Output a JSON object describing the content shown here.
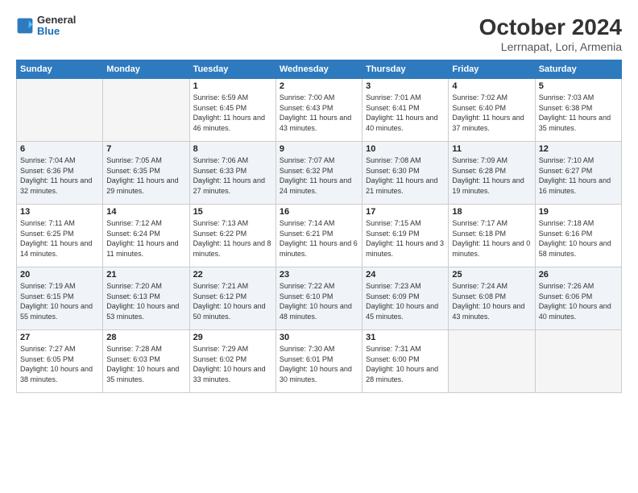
{
  "header": {
    "logo_line1": "General",
    "logo_line2": "Blue",
    "title": "October 2024",
    "subtitle": "Lerrnapat, Lori, Armenia"
  },
  "days_of_week": [
    "Sunday",
    "Monday",
    "Tuesday",
    "Wednesday",
    "Thursday",
    "Friday",
    "Saturday"
  ],
  "weeks": [
    [
      {
        "num": "",
        "info": ""
      },
      {
        "num": "",
        "info": ""
      },
      {
        "num": "1",
        "info": "Sunrise: 6:59 AM\nSunset: 6:45 PM\nDaylight: 11 hours and 46 minutes."
      },
      {
        "num": "2",
        "info": "Sunrise: 7:00 AM\nSunset: 6:43 PM\nDaylight: 11 hours and 43 minutes."
      },
      {
        "num": "3",
        "info": "Sunrise: 7:01 AM\nSunset: 6:41 PM\nDaylight: 11 hours and 40 minutes."
      },
      {
        "num": "4",
        "info": "Sunrise: 7:02 AM\nSunset: 6:40 PM\nDaylight: 11 hours and 37 minutes."
      },
      {
        "num": "5",
        "info": "Sunrise: 7:03 AM\nSunset: 6:38 PM\nDaylight: 11 hours and 35 minutes."
      }
    ],
    [
      {
        "num": "6",
        "info": "Sunrise: 7:04 AM\nSunset: 6:36 PM\nDaylight: 11 hours and 32 minutes."
      },
      {
        "num": "7",
        "info": "Sunrise: 7:05 AM\nSunset: 6:35 PM\nDaylight: 11 hours and 29 minutes."
      },
      {
        "num": "8",
        "info": "Sunrise: 7:06 AM\nSunset: 6:33 PM\nDaylight: 11 hours and 27 minutes."
      },
      {
        "num": "9",
        "info": "Sunrise: 7:07 AM\nSunset: 6:32 PM\nDaylight: 11 hours and 24 minutes."
      },
      {
        "num": "10",
        "info": "Sunrise: 7:08 AM\nSunset: 6:30 PM\nDaylight: 11 hours and 21 minutes."
      },
      {
        "num": "11",
        "info": "Sunrise: 7:09 AM\nSunset: 6:28 PM\nDaylight: 11 hours and 19 minutes."
      },
      {
        "num": "12",
        "info": "Sunrise: 7:10 AM\nSunset: 6:27 PM\nDaylight: 11 hours and 16 minutes."
      }
    ],
    [
      {
        "num": "13",
        "info": "Sunrise: 7:11 AM\nSunset: 6:25 PM\nDaylight: 11 hours and 14 minutes."
      },
      {
        "num": "14",
        "info": "Sunrise: 7:12 AM\nSunset: 6:24 PM\nDaylight: 11 hours and 11 minutes."
      },
      {
        "num": "15",
        "info": "Sunrise: 7:13 AM\nSunset: 6:22 PM\nDaylight: 11 hours and 8 minutes."
      },
      {
        "num": "16",
        "info": "Sunrise: 7:14 AM\nSunset: 6:21 PM\nDaylight: 11 hours and 6 minutes."
      },
      {
        "num": "17",
        "info": "Sunrise: 7:15 AM\nSunset: 6:19 PM\nDaylight: 11 hours and 3 minutes."
      },
      {
        "num": "18",
        "info": "Sunrise: 7:17 AM\nSunset: 6:18 PM\nDaylight: 11 hours and 0 minutes."
      },
      {
        "num": "19",
        "info": "Sunrise: 7:18 AM\nSunset: 6:16 PM\nDaylight: 10 hours and 58 minutes."
      }
    ],
    [
      {
        "num": "20",
        "info": "Sunrise: 7:19 AM\nSunset: 6:15 PM\nDaylight: 10 hours and 55 minutes."
      },
      {
        "num": "21",
        "info": "Sunrise: 7:20 AM\nSunset: 6:13 PM\nDaylight: 10 hours and 53 minutes."
      },
      {
        "num": "22",
        "info": "Sunrise: 7:21 AM\nSunset: 6:12 PM\nDaylight: 10 hours and 50 minutes."
      },
      {
        "num": "23",
        "info": "Sunrise: 7:22 AM\nSunset: 6:10 PM\nDaylight: 10 hours and 48 minutes."
      },
      {
        "num": "24",
        "info": "Sunrise: 7:23 AM\nSunset: 6:09 PM\nDaylight: 10 hours and 45 minutes."
      },
      {
        "num": "25",
        "info": "Sunrise: 7:24 AM\nSunset: 6:08 PM\nDaylight: 10 hours and 43 minutes."
      },
      {
        "num": "26",
        "info": "Sunrise: 7:26 AM\nSunset: 6:06 PM\nDaylight: 10 hours and 40 minutes."
      }
    ],
    [
      {
        "num": "27",
        "info": "Sunrise: 7:27 AM\nSunset: 6:05 PM\nDaylight: 10 hours and 38 minutes."
      },
      {
        "num": "28",
        "info": "Sunrise: 7:28 AM\nSunset: 6:03 PM\nDaylight: 10 hours and 35 minutes."
      },
      {
        "num": "29",
        "info": "Sunrise: 7:29 AM\nSunset: 6:02 PM\nDaylight: 10 hours and 33 minutes."
      },
      {
        "num": "30",
        "info": "Sunrise: 7:30 AM\nSunset: 6:01 PM\nDaylight: 10 hours and 30 minutes."
      },
      {
        "num": "31",
        "info": "Sunrise: 7:31 AM\nSunset: 6:00 PM\nDaylight: 10 hours and 28 minutes."
      },
      {
        "num": "",
        "info": ""
      },
      {
        "num": "",
        "info": ""
      }
    ]
  ]
}
